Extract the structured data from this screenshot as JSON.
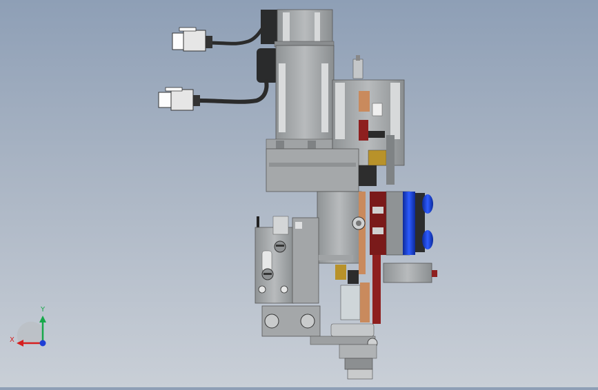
{
  "view": {
    "background_top": "#8e9fb6",
    "background_bottom": "#c9cfd7"
  },
  "model": {
    "body_color": "#a7aaac",
    "dark_body_color": "#7d8183",
    "cable_color": "#2b2b2b",
    "copper_color": "#c98a5d",
    "red_accent_color": "#8e1f1f",
    "blue_accent_color": "#1c44c8",
    "brass_color": "#b8922a"
  },
  "triad": {
    "x_label": "X",
    "y_label": "Y",
    "x_color": "#d61f1f",
    "y_color": "#17a84a",
    "z_color": "#1f3fd6"
  }
}
